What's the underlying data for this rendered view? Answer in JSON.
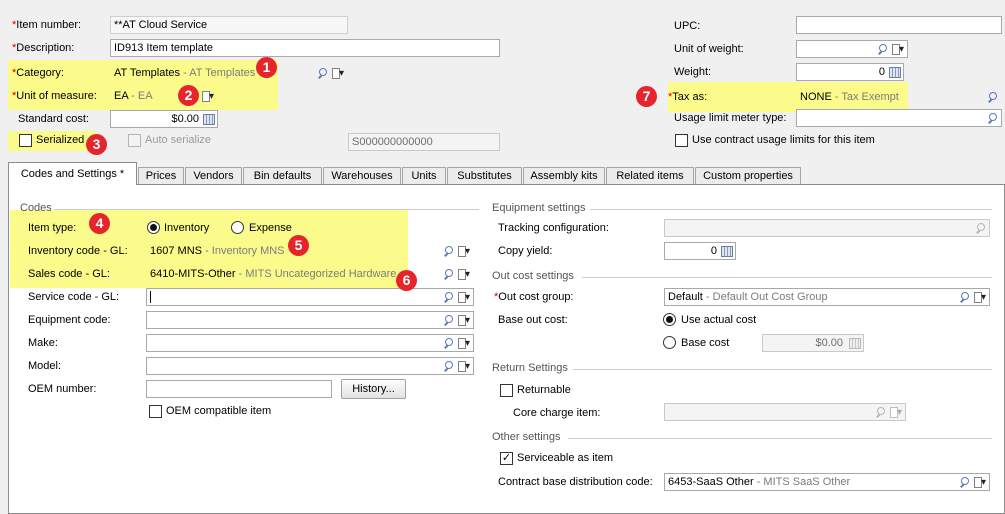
{
  "header": {
    "item_number": {
      "label": "Item number:",
      "value": "**AT Cloud Service"
    },
    "description": {
      "label": "Description:",
      "value": "ID913 Item template"
    },
    "category": {
      "label": "Category:",
      "value": "AT Templates",
      "desc": "- AT Templates"
    },
    "unit_of_measure": {
      "label": "Unit of measure:",
      "value": "EA",
      "desc": "- EA"
    },
    "standard_cost": {
      "label": "Standard cost:",
      "value": "$0.00"
    },
    "serialized": {
      "label": "Serialized",
      "checked": false
    },
    "auto_serialize": {
      "label": "Auto serialize",
      "checked": false
    },
    "serial_value": "S000000000000",
    "upc": {
      "label": "UPC:",
      "value": ""
    },
    "unit_of_weight": {
      "label": "Unit of weight:",
      "value": ""
    },
    "weight": {
      "label": "Weight:",
      "value": "0"
    },
    "tax_as": {
      "label": "Tax as:",
      "value": "NONE",
      "desc": "- Tax Exempt"
    },
    "usage_limit_meter_type": {
      "label": "Usage limit meter type:",
      "value": ""
    },
    "use_contract_usage": {
      "label": "Use contract usage limits for this item",
      "checked": false
    }
  },
  "callouts": [
    "1",
    "2",
    "3",
    "4",
    "5",
    "6",
    "7"
  ],
  "tabs": [
    {
      "label": "Codes and Settings",
      "marker": "*",
      "active": true
    },
    {
      "label": "Prices"
    },
    {
      "label": "Vendors"
    },
    {
      "label": "Bin defaults"
    },
    {
      "label": "Warehouses"
    },
    {
      "label": "Units"
    },
    {
      "label": "Substitutes"
    },
    {
      "label": "Assembly kits"
    },
    {
      "label": "Related items"
    },
    {
      "label": "Custom properties"
    }
  ],
  "codes": {
    "group_title": "Codes",
    "item_type": {
      "label": "Item type:",
      "options": [
        "Inventory",
        "Expense"
      ],
      "selected": "Inventory"
    },
    "inventory_code": {
      "label": "Inventory code - GL:",
      "value": "1607 MNS",
      "desc": "- Inventory MNS"
    },
    "sales_code": {
      "label": "Sales code - GL:",
      "value": "6410-MITS-Other",
      "desc": "- MITS Uncategorized Hardware"
    },
    "service_code": {
      "label": "Service code - GL:",
      "value": ""
    },
    "equipment_code": {
      "label": "Equipment code:",
      "value": ""
    },
    "make": {
      "label": "Make:",
      "value": ""
    },
    "model": {
      "label": "Model:",
      "value": ""
    },
    "oem_number": {
      "label": "OEM number:",
      "value": ""
    },
    "history_button": "History...",
    "oem_compatible": {
      "label": "OEM compatible item",
      "checked": false
    }
  },
  "equipment_settings": {
    "group_title": "Equipment settings",
    "tracking_configuration": {
      "label": "Tracking configuration:",
      "value": ""
    },
    "copy_yield": {
      "label": "Copy yield:",
      "value": "0"
    }
  },
  "out_cost_settings": {
    "group_title": "Out cost settings",
    "out_cost_group": {
      "label": "Out cost group:",
      "value": "Default",
      "desc": "- Default Out Cost Group"
    },
    "base_out_cost": {
      "label": "Base out cost:",
      "options": [
        "Use actual cost",
        "Base cost"
      ],
      "selected": "Use actual cost"
    },
    "base_cost_value": "$0.00"
  },
  "return_settings": {
    "group_title": "Return Settings",
    "returnable": {
      "label": "Returnable",
      "checked": false
    },
    "core_charge_item": {
      "label": "Core charge item:",
      "value": ""
    }
  },
  "other_settings": {
    "group_title": "Other settings",
    "serviceable": {
      "label": "Serviceable as item",
      "checked": true
    },
    "contract_base_distribution": {
      "label": "Contract base distribution code:",
      "value": "6453-SaaS Other",
      "desc": "- MITS SaaS Other"
    }
  },
  "colors": {
    "highlight": "#fbfb8b",
    "callout": "#e5242c",
    "required": "#d40000"
  }
}
